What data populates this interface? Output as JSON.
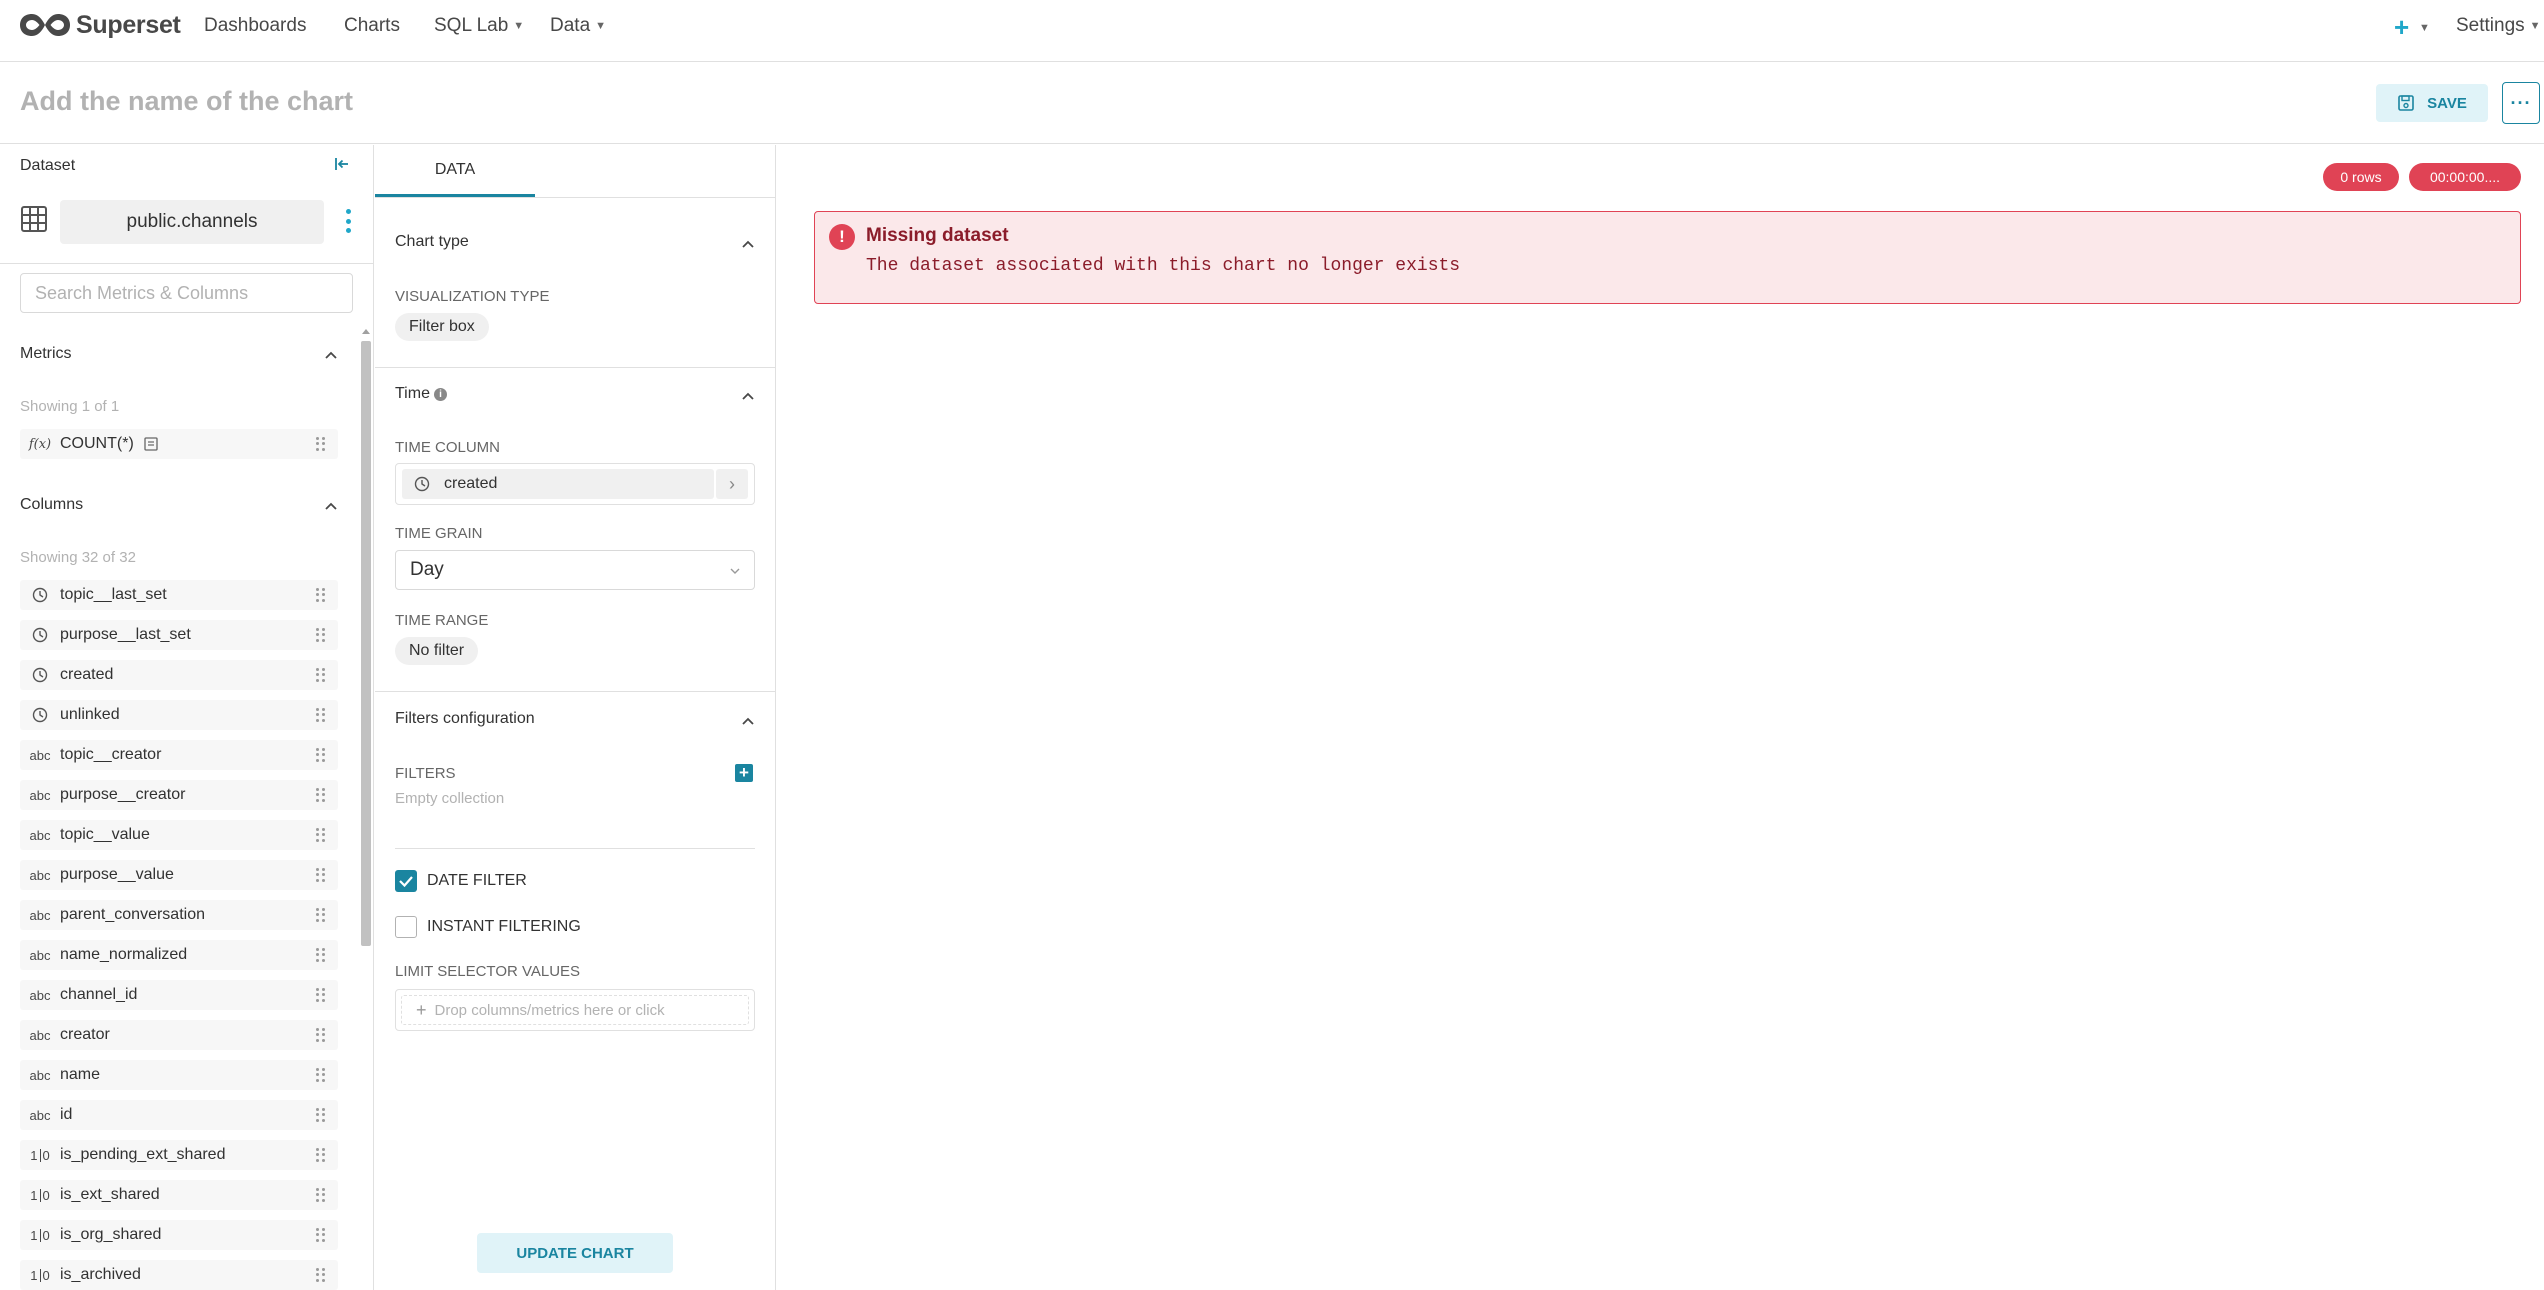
{
  "nav": {
    "brand": "Superset",
    "items": [
      {
        "label": "Dashboards",
        "caret": false
      },
      {
        "label": "Charts",
        "caret": false
      },
      {
        "label": "SQL Lab",
        "caret": true
      },
      {
        "label": "Data",
        "caret": true
      }
    ],
    "plus_icon": "plus-icon",
    "settings_label": "Settings"
  },
  "header": {
    "chart_name_placeholder": "Add the name of the chart",
    "save_label": "SAVE",
    "more_label": "···"
  },
  "dataset": {
    "title": "Dataset",
    "name": "public.channels",
    "search_placeholder": "Search Metrics & Columns",
    "metrics_title": "Metrics",
    "metrics_showing": "Showing 1 of 1",
    "metrics": [
      {
        "type": "f(x)",
        "label": "COUNT(*)"
      }
    ],
    "columns_title": "Columns",
    "columns_showing": "Showing 32 of 32",
    "columns": [
      {
        "type": "time",
        "label": "topic__last_set"
      },
      {
        "type": "time",
        "label": "purpose__last_set"
      },
      {
        "type": "time",
        "label": "created"
      },
      {
        "type": "time",
        "label": "unlinked"
      },
      {
        "type": "abc",
        "label": "topic__creator"
      },
      {
        "type": "abc",
        "label": "purpose__creator"
      },
      {
        "type": "abc",
        "label": "topic__value"
      },
      {
        "type": "abc",
        "label": "purpose__value"
      },
      {
        "type": "abc",
        "label": "parent_conversation"
      },
      {
        "type": "abc",
        "label": "name_normalized"
      },
      {
        "type": "abc",
        "label": "channel_id"
      },
      {
        "type": "abc",
        "label": "creator"
      },
      {
        "type": "abc",
        "label": "name"
      },
      {
        "type": "abc",
        "label": "id"
      },
      {
        "type": "bool",
        "label": "is_pending_ext_shared"
      },
      {
        "type": "bool",
        "label": "is_ext_shared"
      },
      {
        "type": "bool",
        "label": "is_org_shared"
      },
      {
        "type": "bool",
        "label": "is_archived"
      }
    ]
  },
  "controls": {
    "tab_label": "DATA",
    "chart_type_section": "Chart type",
    "viz_type_label": "VISUALIZATION TYPE",
    "viz_type_value": "Filter box",
    "time_section": "Time",
    "time_column_label": "TIME COLUMN",
    "time_column_value": "created",
    "time_grain_label": "TIME GRAIN",
    "time_grain_value": "Day",
    "time_range_label": "TIME RANGE",
    "time_range_value": "No filter",
    "filters_section": "Filters configuration",
    "filters_label": "FILTERS",
    "filters_empty": "Empty collection",
    "date_filter_label": "DATE FILTER",
    "date_filter_checked": true,
    "instant_filtering_label": "INSTANT FILTERING",
    "instant_filtering_checked": false,
    "limit_selector_label": "LIMIT SELECTOR VALUES",
    "limit_selector_placeholder": "Drop columns/metrics here or click",
    "update_label": "UPDATE CHART"
  },
  "chart": {
    "rows_badge": "0 rows",
    "time_badge": "00:00:00....",
    "alert_title": "Missing dataset",
    "alert_message": "The dataset associated with this chart no longer exists"
  },
  "colors": {
    "primary": "#1a85a0",
    "primary_light": "#e0f3f8",
    "danger": "#e04355",
    "danger_bg": "#fbe8ea"
  }
}
